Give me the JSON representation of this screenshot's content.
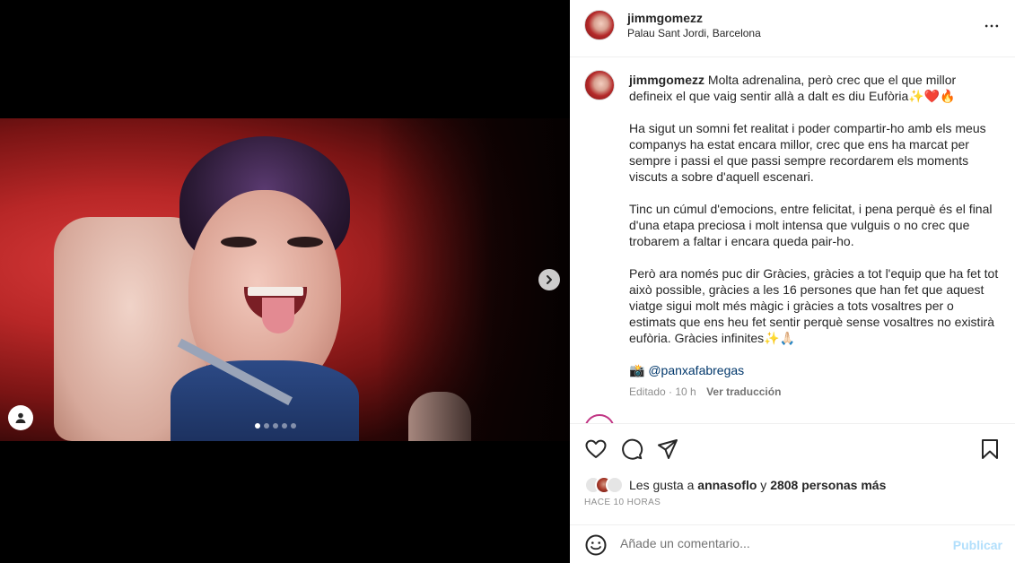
{
  "post": {
    "username": "jimmgomezz",
    "location": "Palau Sant Jordi, Barcelona",
    "caption_paragraphs": [
      "Molta adrenalina, però crec que el que millor defineix el que vaig sentir allà a dalt es diu Eufòria✨❤️🔥",
      "Ha sigut un somni fet realitat i poder compartir-ho amb els meus companys ha estat encara millor, crec que ens ha marcat per sempre i passi el que passi sempre recordarem els moments viscuts a sobre d'aquell escenari.",
      "Tinc un cúmul d'emocions, entre felicitat, i pena perquè és el final d'una etapa preciosa i molt intensa que vulguis o no crec que trobarem a faltar i encara queda pair-ho.",
      "Però ara només puc dir Gràcies, gràcies a tot l'equip que ha fet tot això possible, gràcies a les 16 persones que han fet que aquest viatge sigui molt més màgic i gràcies a tots vosaltres per o estimats que ens heu fet sentir perquè sense vosaltres no existirà eufòria. Gràcies infinites✨🙏🏻"
    ],
    "credit_emoji": "📸",
    "credit_mention": "@panxafabregas",
    "edited_label": "Editado · 10 h",
    "translate_label": "Ver traducción",
    "likes_prefix": "Les gusta a ",
    "likes_user": "annasoflo",
    "likes_mid": " y ",
    "likes_count": "2808 personas más",
    "time_ago": "HACE 10 HORAS",
    "comment_placeholder": "Añade un comentario...",
    "publish_label": "Publicar"
  },
  "carousel": {
    "slide_count": 5,
    "active_slide": 1
  },
  "icons": {
    "like": "heart-icon",
    "comment": "comment-icon",
    "share": "paper-plane-icon",
    "save": "bookmark-icon",
    "more": "more-options-icon",
    "next": "chevron-right-icon",
    "tag": "user-tag-icon",
    "emoji": "emoji-icon"
  },
  "colors": {
    "link": "#00376b",
    "publish_disabled": "#b2dffc",
    "muted": "#8e8e8e"
  }
}
